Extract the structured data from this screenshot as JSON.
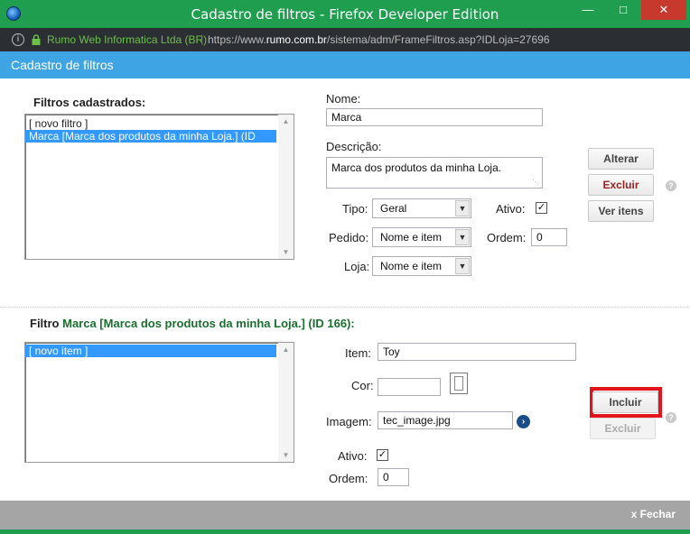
{
  "window": {
    "title": "Cadastro de filtros - Firefox Developer Edition",
    "minimize_icon": "minimize-icon",
    "maximize_icon": "maximize-icon",
    "close_icon": "close-icon"
  },
  "urlbar": {
    "org": "Rumo Web Informatica Ltda (BR)",
    "url": "https://www.rumo.com.br/sistema/adm/FrameFiltros.asp?IDLoja=27696",
    "url_prefix": "https://www.",
    "url_domain": "rumo.com.br",
    "url_rest": "/sistema/adm/FrameFiltros.asp?IDLoja=27696"
  },
  "dialog": {
    "title": "Cadastro de filtros",
    "header_color": "#3ea4e3"
  },
  "filters": {
    "heading": "Filtros cadastrados:",
    "items": [
      {
        "label": "[ novo filtro ]",
        "selected": false
      },
      {
        "label": "Marca [Marca dos produtos da minha Loja.] (ID",
        "selected": true
      }
    ]
  },
  "filter_form": {
    "nome_label": "Nome:",
    "nome_value": "Marca",
    "descricao_label": "Descrição:",
    "descricao_value": "Marca dos produtos da minha Loja.",
    "tipo_label": "Tipo:",
    "tipo_value": "Geral",
    "ativo_label": "Ativo:",
    "ativo_checked": true,
    "pedido_label": "Pedido:",
    "pedido_value": "Nome e item",
    "ordem_label": "Ordem:",
    "ordem_value": "0",
    "loja_label": "Loja:",
    "loja_value": "Nome e item",
    "alterar_label": "Alterar",
    "excluir_label": "Excluir",
    "ver_itens_label": "Ver itens",
    "help_text": "?"
  },
  "items_section": {
    "heading_prefix": "Filtro ",
    "heading_name": "Marca [Marca dos produtos da minha Loja.] (ID 166):",
    "items": [
      {
        "label": "[ novo item ]",
        "selected": true
      }
    ]
  },
  "item_form": {
    "item_label": "Item:",
    "item_value": "Toy",
    "cor_label": "Cor:",
    "cor_value": "",
    "imagem_label": "Imagem:",
    "imagem_value": "tec_image.jpg",
    "ativo_label": "Ativo:",
    "ativo_checked": true,
    "ordem_label": "Ordem:",
    "ordem_value": "0",
    "incluir_label": "Incluir",
    "excluir_label": "Excluir",
    "help_text": "?",
    "highlight_color": "#e3141c"
  },
  "footer": {
    "close_label": "x Fechar"
  }
}
